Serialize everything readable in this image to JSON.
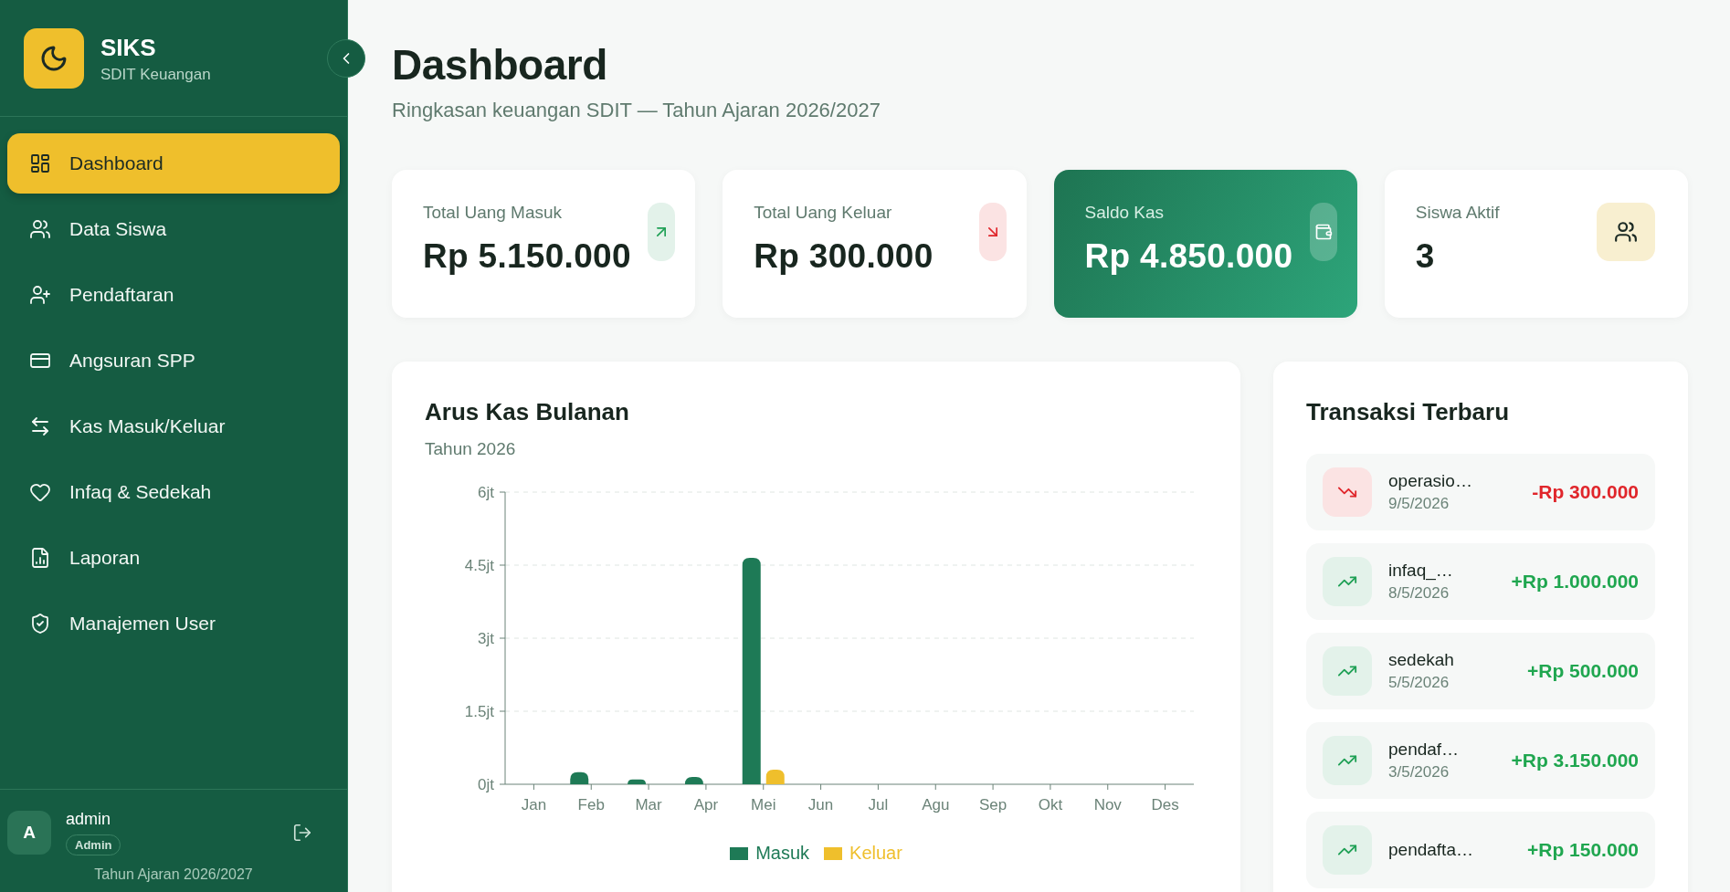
{
  "sidebar": {
    "brand": {
      "name": "SIKS",
      "subtitle": "SDIT Keuangan"
    },
    "items": [
      {
        "label": "Dashboard",
        "kind": "dashboard",
        "selected": true
      },
      {
        "label": "Data Siswa",
        "kind": "students",
        "selected": false
      },
      {
        "label": "Pendaftaran",
        "kind": "register",
        "selected": false
      },
      {
        "label": "Angsuran SPP",
        "kind": "card",
        "selected": false
      },
      {
        "label": "Kas Masuk/Keluar",
        "kind": "transfer",
        "selected": false
      },
      {
        "label": "Infaq & Sedekah",
        "kind": "heart",
        "selected": false
      },
      {
        "label": "Laporan",
        "kind": "report",
        "selected": false
      },
      {
        "label": "Manajemen User",
        "kind": "shield",
        "selected": false
      }
    ],
    "user": {
      "initial": "A",
      "name": "admin",
      "role": "Admin"
    },
    "footer": "Tahun Ajaran 2026/2027"
  },
  "header": {
    "title": "Dashboard",
    "subtitle": "Ringkasan keuangan SDIT — Tahun Ajaran 2026/2027"
  },
  "stats": [
    {
      "label": "Total Uang Masuk",
      "value": "Rp 5.150.000",
      "kind": "income"
    },
    {
      "label": "Total Uang Keluar",
      "value": "Rp 300.000",
      "kind": "expense"
    },
    {
      "label": "Saldo Kas",
      "value": "Rp 4.850.000",
      "kind": "balance"
    },
    {
      "label": "Siswa Aktif",
      "value": "3",
      "kind": "students"
    }
  ],
  "cashflow": {
    "title": "Arus Kas Bulanan",
    "subtitle": "Tahun 2026",
    "chart_data": {
      "type": "bar",
      "categories": [
        "Jan",
        "Feb",
        "Mar",
        "Apr",
        "Mei",
        "Jun",
        "Jul",
        "Agu",
        "Sep",
        "Okt",
        "Nov",
        "Des"
      ],
      "series": [
        {
          "name": "Masuk",
          "color": "#1e7a56",
          "values": [
            0,
            0.25,
            0.1,
            0.15,
            4.65,
            0,
            0,
            0,
            0,
            0,
            0,
            0
          ]
        },
        {
          "name": "Keluar",
          "color": "#efbf2c",
          "values": [
            0,
            0,
            0,
            0,
            0.3,
            0,
            0,
            0,
            0,
            0,
            0,
            0
          ]
        }
      ],
      "grid": true,
      "ylim": [
        0,
        6
      ],
      "yticks": [
        {
          "value": 0,
          "label": "0jt"
        },
        {
          "value": 1.5,
          "label": "1.5jt"
        },
        {
          "value": 3,
          "label": "3jt"
        },
        {
          "value": 4.5,
          "label": "4.5jt"
        },
        {
          "value": 6,
          "label": "6jt"
        }
      ]
    }
  },
  "transactions": {
    "title": "Transaksi Terbaru",
    "items": [
      {
        "name": "operasio…",
        "date": "9/5/2026",
        "amount": "-Rp 300.000",
        "kind": "out"
      },
      {
        "name": "infaq_…",
        "date": "8/5/2026",
        "amount": "+Rp 1.000.000",
        "kind": "in"
      },
      {
        "name": "sedekah",
        "date": "5/5/2026",
        "amount": "+Rp 500.000",
        "kind": "in"
      },
      {
        "name": "pendaf…",
        "date": "3/5/2026",
        "amount": "+Rp 3.150.000",
        "kind": "in"
      },
      {
        "name": "pendafta…",
        "amount": "+Rp 150.000",
        "kind": "in"
      }
    ]
  }
}
